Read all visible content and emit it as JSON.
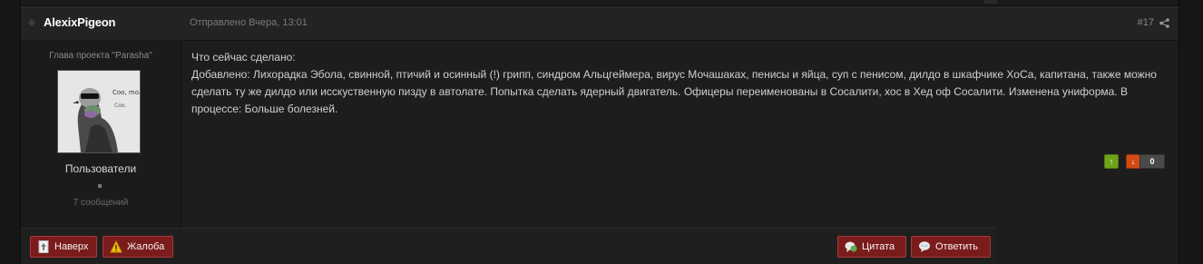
{
  "post": {
    "username": "AlexixPigeon",
    "date": "Отправлено Вчера, 13:01",
    "number": "#17",
    "author": {
      "title": "Глава проекта \"Parasha\"",
      "group": "Пользователи",
      "post_count": "7 сообщений",
      "avatar_text": "Coo, mo... Coo."
    },
    "content": {
      "line1": "Что сейчас сделано:",
      "line2": "Добавлено: Лихорадка Эбола, свинной, птичий и осинный (!) грипп, синдром Альцгеймера, вирус Мочашаках, пенисы и яйца, суп с пенисом, дилдо в шкафчике ХоСа, капитана, также можно сделать ту же дилдо или исскуственную пизду в автолате. Попытка сделать ядерный двигатель. Офицеры переименованы в Сосалити, хос в Хед оф Сосалити. Изменена униформа. В процессе: Больше болезней."
    },
    "reputation": {
      "count": "0",
      "up_color": "#6ea21a",
      "down_color": "#d24a14"
    }
  },
  "footer": {
    "top_label": "Наверх",
    "report_label": "Жалоба",
    "quote_label": "Цитата",
    "reply_label": "Ответить"
  },
  "icons": {
    "status": "status-dot-icon",
    "share": "share-icon",
    "top": "page-up-icon",
    "report": "warning-icon",
    "quote": "quote-bubble-icon",
    "reply": "reply-bubble-icon"
  }
}
